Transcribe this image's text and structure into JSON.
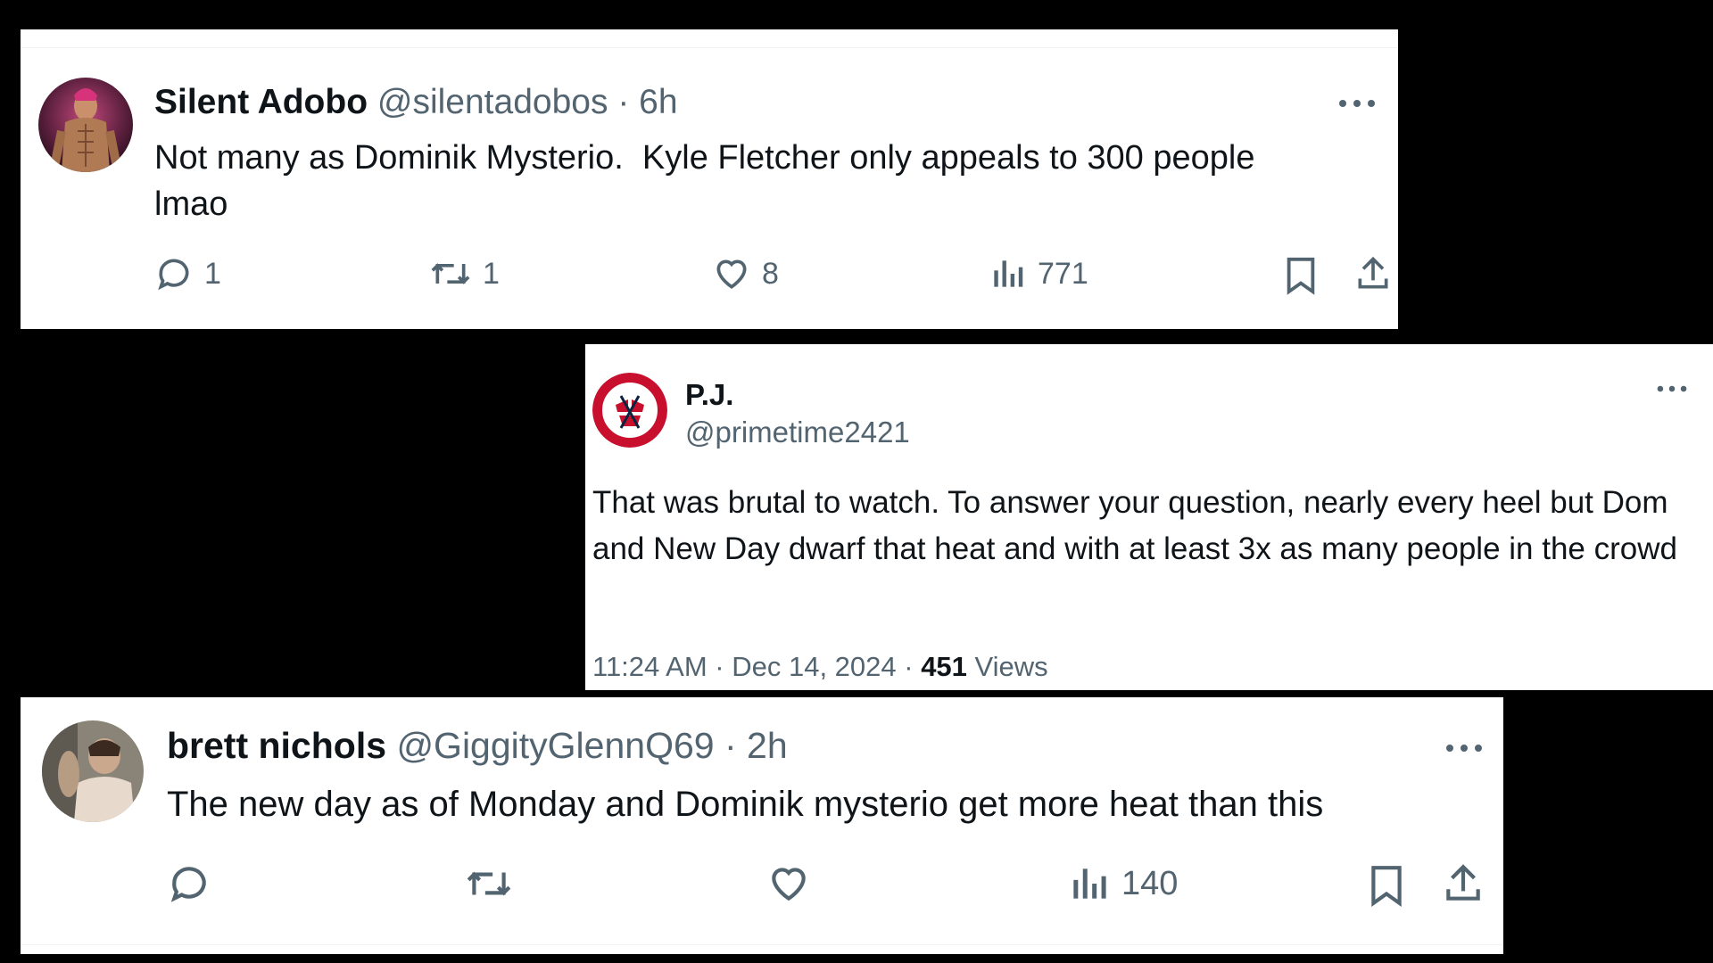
{
  "tweets": [
    {
      "name": "Silent Adobo",
      "handle": "@silentadobos",
      "separator": "·",
      "time": "6h",
      "text": "Not many as Dominik Mysterio.  Kyle Fletcher only appeals to 300 people lmao",
      "actions": {
        "replies": "1",
        "reposts": "1",
        "likes": "8",
        "views": "771"
      },
      "icons": [
        "more-icon",
        "reply-icon",
        "repost-icon",
        "like-icon",
        "views-icon",
        "bookmark-icon",
        "share-icon"
      ]
    },
    {
      "name": "P.J.",
      "handle": "@primetime2421",
      "text": "That was brutal to watch. To answer your question, nearly every heel but Dom and New Day dwarf that heat and with at least 3x as many people in the crowd",
      "timestamp": "11:24 AM · Dec 14, 2024 · ",
      "views_count": "451",
      "views_label": " Views",
      "icons": [
        "more-icon"
      ]
    },
    {
      "name": "brett nichols",
      "handle": "@GiggityGlennQ69",
      "separator": "·",
      "time": "2h",
      "text": "The new day as of Monday and Dominik mysterio get more heat than this",
      "actions": {
        "views": "140"
      },
      "icons": [
        "more-icon",
        "reply-icon",
        "repost-icon",
        "like-icon",
        "views-icon",
        "bookmark-icon",
        "share-icon"
      ]
    }
  ],
  "colors": {
    "background": "#000000",
    "card": "#ffffff",
    "text_primary": "#0f1419",
    "text_secondary": "#536471",
    "divider": "#eff3f4",
    "redsox_red": "#c8102e",
    "redsox_navy": "#0c2340"
  }
}
